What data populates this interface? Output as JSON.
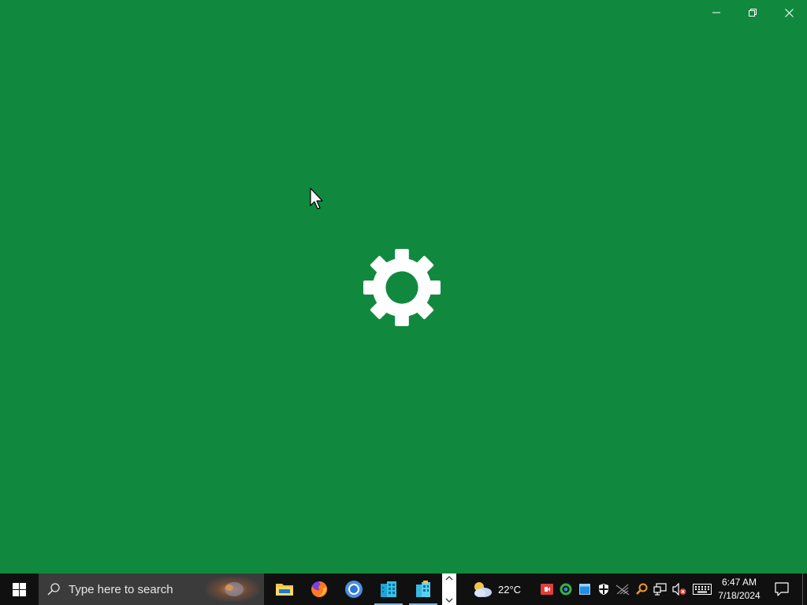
{
  "window": {
    "background_color": "#10893e",
    "controls": {
      "minimize": "minimize-icon",
      "restore": "restore-icon",
      "close": "close-icon"
    },
    "splash_icon": "gear-icon"
  },
  "taskbar": {
    "start_icon": "windows-logo-icon",
    "search": {
      "placeholder": "Type here to search"
    },
    "pinned_apps": [
      {
        "name": "File Explorer",
        "icon": "folder-icon",
        "active": false
      },
      {
        "name": "Firefox",
        "icon": "firefox-icon",
        "active": false
      },
      {
        "name": "Chrome",
        "icon": "chrome-icon",
        "active": false
      },
      {
        "name": "Buildings app",
        "icon": "buildings-icon",
        "active": true
      },
      {
        "name": "Buildings app 2",
        "icon": "buildings-icon",
        "active": true
      }
    ],
    "weather": {
      "temperature": "22°C",
      "icon": "partly-cloudy-icon"
    },
    "tray_icons": [
      "record-icon",
      "sync-icon",
      "window-icon",
      "shield-icon",
      "network-disabled-icon",
      "search-tool-icon",
      "monitor-network-icon",
      "speaker-muted-icon",
      "keyboard-icon"
    ],
    "clock": {
      "time": "6:47 AM",
      "date": "7/18/2024"
    },
    "notification_icon": "notification-icon"
  }
}
